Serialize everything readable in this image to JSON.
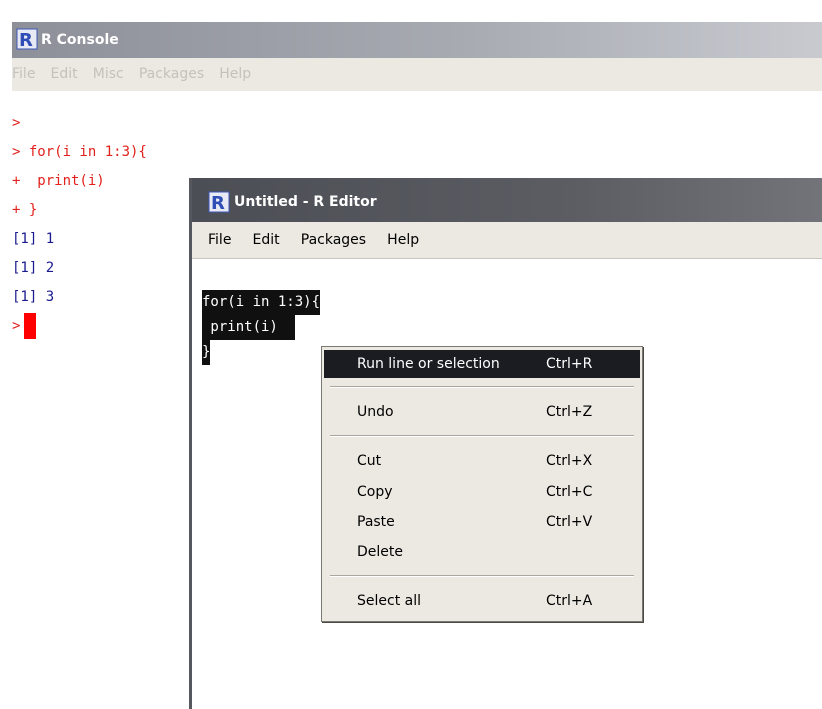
{
  "console": {
    "title": "R Console",
    "menu": [
      "File",
      "Edit",
      "Misc",
      "Packages",
      "Help"
    ],
    "lines": [
      {
        "text": ">",
        "color": "red"
      },
      {
        "text": "> for(i in 1:3){",
        "color": "red"
      },
      {
        "text": "+  print(i)",
        "color": "red"
      },
      {
        "text": "+ }",
        "color": "red"
      },
      {
        "text": "[1] 1",
        "color": "blue"
      },
      {
        "text": "[1] 2",
        "color": "blue"
      },
      {
        "text": "[1] 3",
        "color": "blue"
      }
    ],
    "prompt": ">"
  },
  "editor": {
    "title": "Untitled - R Editor",
    "menu": [
      "File",
      "Edit",
      "Packages",
      "Help"
    ],
    "code": [
      "for(i in 1:3){",
      " print(i)  ",
      "}"
    ]
  },
  "context_menu": {
    "run": {
      "label": "Run line or selection",
      "shortcut": "Ctrl+R"
    },
    "undo": {
      "label": "Undo",
      "shortcut": "Ctrl+Z"
    },
    "cut": {
      "label": "Cut",
      "shortcut": "Ctrl+X"
    },
    "copy": {
      "label": "Copy",
      "shortcut": "Ctrl+C"
    },
    "paste": {
      "label": "Paste",
      "shortcut": "Ctrl+V"
    },
    "delete": {
      "label": "Delete",
      "shortcut": ""
    },
    "select_all": {
      "label": "Select all",
      "shortcut": "Ctrl+A"
    }
  },
  "colors": {
    "prompt_red": "#e2211c",
    "output_blue": "#1a1a8f",
    "cursor_red": "#ff0000",
    "menu_bg": "#ebe9e2",
    "highlight": "#1b1c22"
  }
}
